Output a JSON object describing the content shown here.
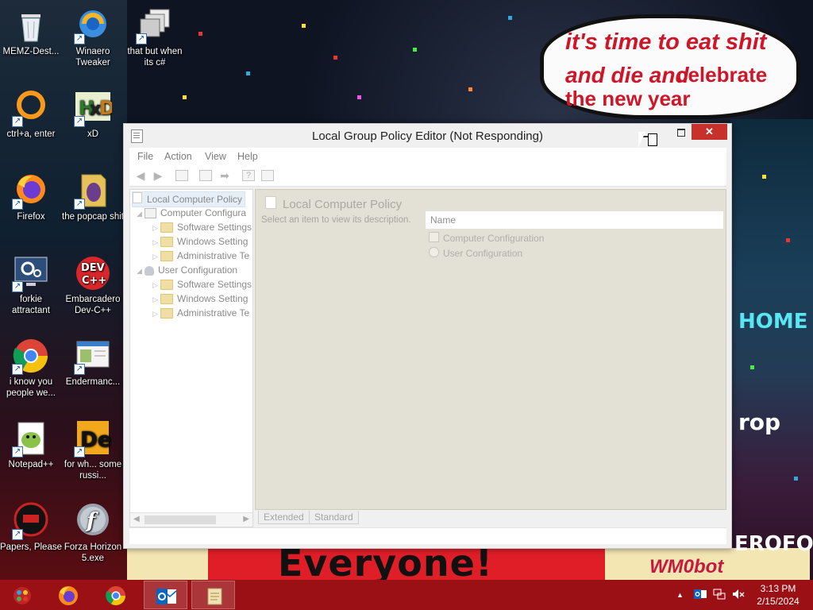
{
  "wallpaper": {
    "bubble_line1": "it's time to eat shit",
    "bubble_line2": "and die and",
    "bubble_line2b": "celebrate",
    "bubble_line3": "the new year",
    "banner_text": "Everyone!",
    "corner_text": "WM0bot",
    "neon_home": "HOME",
    "neon_rop": "rop",
    "neon_eroos": "EROFOS"
  },
  "desktop_icons": [
    {
      "label": "MEMZ-Dest...",
      "icon": "recycle-bin-icon"
    },
    {
      "label": "Winaero Tweaker",
      "icon": "winaero-icon"
    },
    {
      "label": "that but when its c#",
      "icon": "windows-stack-icon"
    },
    {
      "label": "ctrl+a, enter",
      "icon": "ring-icon"
    },
    {
      "label": "xD",
      "icon": "hxd-icon"
    },
    {
      "label": "Firefox",
      "icon": "firefox-icon"
    },
    {
      "label": "the popcap shit",
      "icon": "popcap-icon"
    },
    {
      "label": "forkie attractant",
      "icon": "monitor-gear-icon"
    },
    {
      "label": "Embarcadero Dev-C++",
      "icon": "devcpp-icon"
    },
    {
      "label": "i know you people we...",
      "icon": "chrome-icon"
    },
    {
      "label": "Endermanc...",
      "icon": "window-app-icon"
    },
    {
      "label": "Notepad++",
      "icon": "notepadpp-icon"
    },
    {
      "label": "for wh... some russi...",
      "icon": "de-icon"
    },
    {
      "label": "Papers, Please",
      "icon": "papers-please-icon"
    },
    {
      "label": "Forza Horizon 5.exe",
      "icon": "flash-icon"
    }
  ],
  "window": {
    "title": "Local Group Policy Editor (Not Responding)",
    "close_glyph": "✕",
    "menu": [
      "File",
      "Action",
      "View",
      "Help"
    ],
    "tree": {
      "root": "Local Computer Policy",
      "computer": "Computer Configura",
      "computer_children": [
        "Software Settings",
        "Windows Setting",
        "Administrative Te"
      ],
      "user": "User Configuration",
      "user_children": [
        "Software Settings",
        "Windows Setting",
        "Administrative Te"
      ]
    },
    "right": {
      "title": "Local Computer Policy",
      "description": "Select an item to view its description.",
      "column_name": "Name",
      "items": [
        "Computer Configuration",
        "User Configuration"
      ]
    },
    "tabs": [
      "Extended",
      "Standard"
    ]
  },
  "taskbar": {
    "apps": [
      "start-orb-icon",
      "firefox-icon",
      "chrome-icon",
      "outlook-icon",
      "scroll-icon"
    ],
    "time": "3:13 PM",
    "date": "2/15/2024"
  }
}
